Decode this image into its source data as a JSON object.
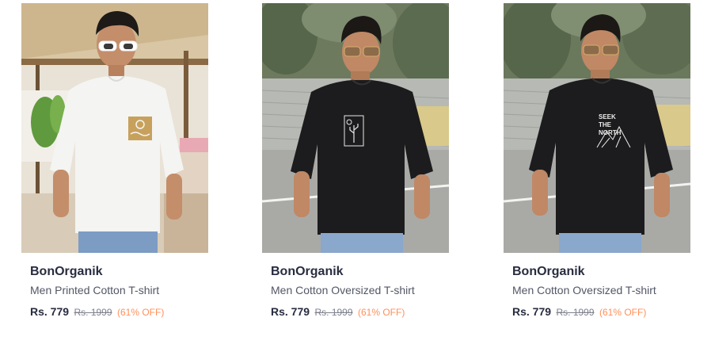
{
  "products": [
    {
      "brand": "BonOrganik",
      "name": "Men Printed Cotton T-shirt",
      "price": "Rs. 779",
      "mrp": "Rs. 1999",
      "discount": "(61% OFF)",
      "image_label": "white-printed-tshirt-image",
      "tshirt_color": "#f4f4f2",
      "print_text": ""
    },
    {
      "brand": "BonOrganik",
      "name": "Men Cotton Oversized T-shirt",
      "price": "Rs. 779",
      "mrp": "Rs. 1999",
      "discount": "(61% OFF)",
      "image_label": "black-cactus-tshirt-image",
      "tshirt_color": "#1c1c1e",
      "print_text": ""
    },
    {
      "brand": "BonOrganik",
      "name": "Men Cotton Oversized T-shirt",
      "price": "Rs. 779",
      "mrp": "Rs. 1999",
      "discount": "(61% OFF)",
      "image_label": "black-mountain-tshirt-image",
      "tshirt_color": "#1c1c1e",
      "print_text": "SEEK THE NORTH"
    }
  ],
  "colors": {
    "brand_text": "#282c3f",
    "name_text": "#535766",
    "mrp_text": "#7e818c",
    "discount_text": "#ff905a"
  }
}
